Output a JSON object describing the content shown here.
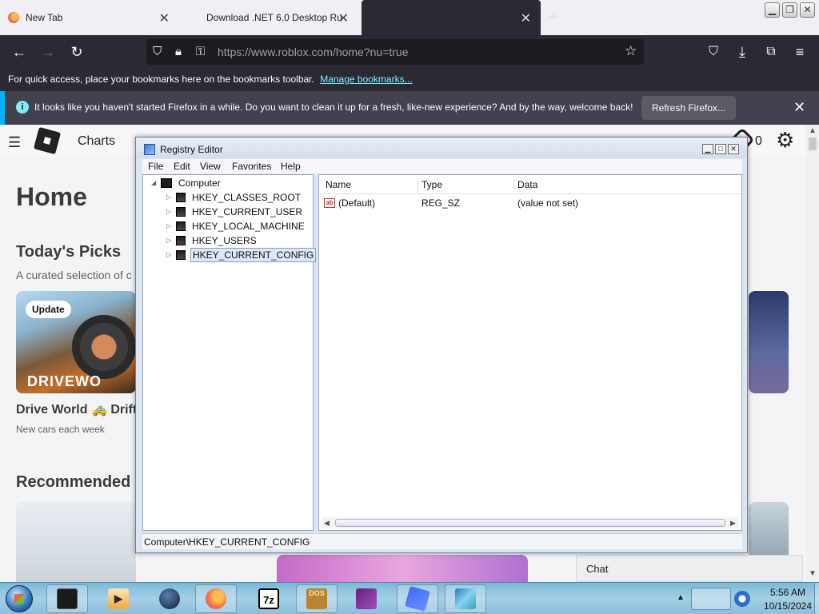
{
  "browser": {
    "tabs": [
      {
        "label": "New Tab"
      },
      {
        "label": "Download .NET 6.0 Desktop Ru"
      },
      {
        "label": ""
      }
    ],
    "new_tab_glyph": "+",
    "url": "https://www.roblox.com/home?nu=true",
    "bookmarks_text": "For quick access, place your bookmarks here on the bookmarks toolbar.",
    "bookmarks_link": "Manage bookmarks...",
    "notice_text": "It looks like you haven't started Firefox in a while. Do you want to clean it up for a fresh, like-new experience? And by the way, welcome back!",
    "notice_button": "Refresh Firefox...",
    "accent_color": "#00b3f4"
  },
  "roblox": {
    "nav_charts": "Charts",
    "robux": "0",
    "home_title": "Home",
    "todays_picks": "Today's Picks",
    "picks_sub": "A curated selection of c",
    "update_badge": "Update",
    "game_brand": "DRIVEWO",
    "game_title": "Drive World 🚕 Drift",
    "game_sub": "New cars each week",
    "recommended": "Recommended",
    "chat": "Chat"
  },
  "regedit": {
    "title": "Registry Editor",
    "menu": [
      "File",
      "Edit",
      "View",
      "Favorites",
      "Help"
    ],
    "tree_root": "Computer",
    "tree_items": [
      "HKEY_CLASSES_ROOT",
      "HKEY_CURRENT_USER",
      "HKEY_LOCAL_MACHINE",
      "HKEY_USERS",
      "HKEY_CURRENT_CONFIG"
    ],
    "selected_item": "HKEY_CURRENT_CONFIG",
    "columns": [
      "Name",
      "Type",
      "Data"
    ],
    "rows": [
      {
        "name": "(Default)",
        "type": "REG_SZ",
        "data": "(value not set)"
      }
    ],
    "status": "Computer\\HKEY_CURRENT_CONFIG"
  },
  "taskbar": {
    "apps": [
      {
        "name": "terminal-icon",
        "glyph": ""
      },
      {
        "name": "media-player-icon",
        "glyph": "▶"
      },
      {
        "name": "globe-icon",
        "glyph": ""
      },
      {
        "name": "firefox-icon",
        "glyph": ""
      },
      {
        "name": "7zip-icon",
        "glyph": "7z"
      },
      {
        "name": "dosbox-icon",
        "glyph": "DOS"
      },
      {
        "name": "visual-studio-icon",
        "glyph": ""
      },
      {
        "name": "roblox-studio-icon",
        "glyph": ""
      },
      {
        "name": "registry-editor-icon",
        "glyph": ""
      }
    ],
    "time": "5:56 AM",
    "date": "10/15/2024"
  }
}
